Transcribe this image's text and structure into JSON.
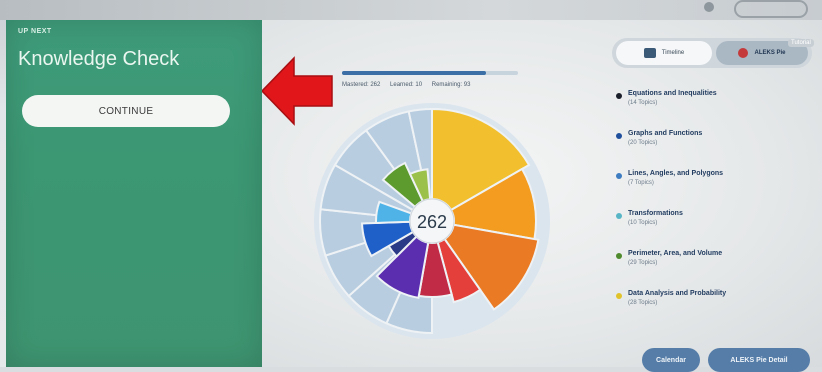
{
  "left_panel": {
    "up_next": "UP NEXT",
    "title": "Knowledge Check",
    "continue_label": "CONTINUE"
  },
  "progress": {
    "fraction": 0.82,
    "mastered_label": "Mastered: 262",
    "learned_label": "Learned: 10",
    "remaining_label": "Remaining: 93"
  },
  "pie": {
    "center_value": "262",
    "colors": [
      "#f2c02e",
      "#f39c1f",
      "#ea7a23",
      "#e43f3a",
      "#c22b45",
      "#5b2eb0",
      "#2a3a86",
      "#1f5fc8",
      "#4fb3e8",
      "#5d9b2f",
      "#9bc14a"
    ]
  },
  "toggle": {
    "timeline_label": "Timeline",
    "pie_label": "ALEKS Pie",
    "new_badge": "Tutorial"
  },
  "topics": [
    {
      "name": "Equations and Inequalities",
      "count": "(14 Topics)",
      "color": "#1b1f2a"
    },
    {
      "name": "Graphs and Functions",
      "count": "(20 Topics)",
      "color": "#1f4f9c"
    },
    {
      "name": "Lines, Angles, and Polygons",
      "count": "(7 Topics)",
      "color": "#3d7cc0"
    },
    {
      "name": "Transformations",
      "count": "(10 Topics)",
      "color": "#57b5c6"
    },
    {
      "name": "Perimeter, Area, and Volume",
      "count": "(29 Topics)",
      "color": "#4f8a2e"
    },
    {
      "name": "Data Analysis and Probability",
      "count": "(28 Topics)",
      "color": "#e0c22a"
    }
  ],
  "buttons": {
    "calendar": "Calendar",
    "pie_detail": "ALEKS Pie Detail"
  }
}
